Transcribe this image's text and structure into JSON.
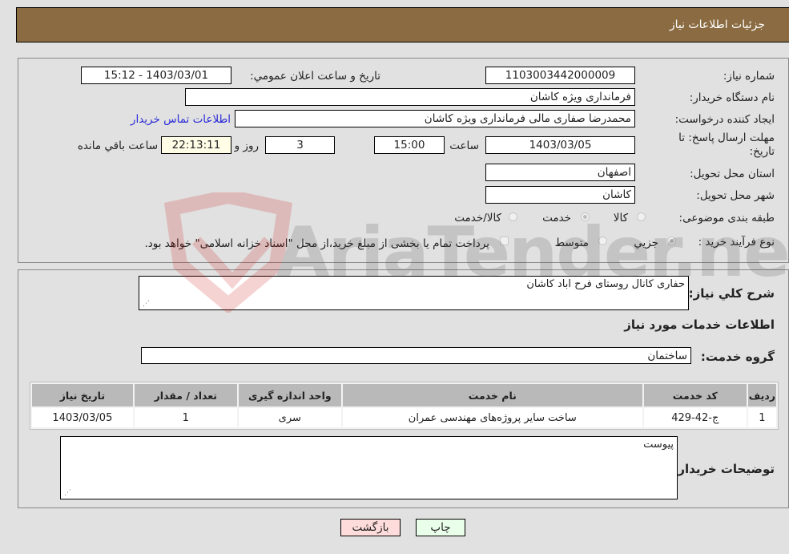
{
  "header": {
    "title": "جزئيات اطلاعات نياز"
  },
  "fields": {
    "need_number": {
      "label": "شماره نياز:",
      "value": "1103003442000009"
    },
    "announce_datetime": {
      "label": "تاريخ و ساعت اعلان عمومي:",
      "value": "1403/03/01 - 15:12"
    },
    "buyer_org": {
      "label": "نام دستگاه خريدار:",
      "value": "فرمانداری ویژه کاشان"
    },
    "requester": {
      "label": "ايجاد کننده درخواست:",
      "value": "محمدرضا صفاری مالی فرمانداری ویژه کاشان",
      "contact_link": "اطلاعات تماس خريدار"
    },
    "deadline": {
      "label_line1": "مهلت ارسال پاسخ: تا",
      "label_line2": "تاريخ:",
      "date": "1403/03/05",
      "time_label": "ساعت",
      "time": "15:00",
      "days": "3",
      "days_label": "روز و",
      "remaining": "22:13:11",
      "remaining_label": "ساعت باقي مانده"
    },
    "province": {
      "label": "استان محل تحويل:",
      "value": "اصفهان"
    },
    "city": {
      "label": "شهر محل تحويل:",
      "value": "کاشان"
    },
    "category": {
      "label": "طبقه بندی موضوعی:",
      "options": [
        "کالا",
        "خدمت",
        "کالا/خدمت"
      ],
      "selected": "خدمت"
    },
    "purchase_type": {
      "label": "نوع فرآيند خريد :",
      "options": [
        "جزيي",
        "متوسط"
      ],
      "selected": "جزيي",
      "treasury_note": "پرداخت تمام يا بخشی از مبلغ خريد،از محل \"اسناد خزانه اسلامی\" خواهد بود."
    }
  },
  "description": {
    "label": "شرح کلي نياز:",
    "value": "حفاری کانال روستای فرح اباد کاشان"
  },
  "services_section": {
    "title": "اطلاعات خدمات مورد نياز",
    "group_label": "گروه خدمت:",
    "group_value": "ساختمان",
    "table": {
      "columns": [
        "رديف",
        "کد خدمت",
        "نام خدمت",
        "واحد اندازه گيری",
        "تعداد / مقدار",
        "تاريخ نياز"
      ],
      "rows": [
        [
          "1",
          "ج-42-429",
          "ساخت ساير پروژه‌های مهندسی عمران",
          "سری",
          "1",
          "1403/03/05"
        ]
      ]
    }
  },
  "buyer_notes": {
    "label": "توضيحات خريدار:",
    "value": "پيوست"
  },
  "buttons": {
    "print": "چاپ",
    "back": "بازگشت"
  },
  "watermark": {
    "text": "AriaTender.neT"
  },
  "colors": {
    "header_bg": "#8b6c42",
    "print_bg": "#eaffea",
    "back_bg": "#ffdcdc",
    "link": "#2a2ad6"
  }
}
